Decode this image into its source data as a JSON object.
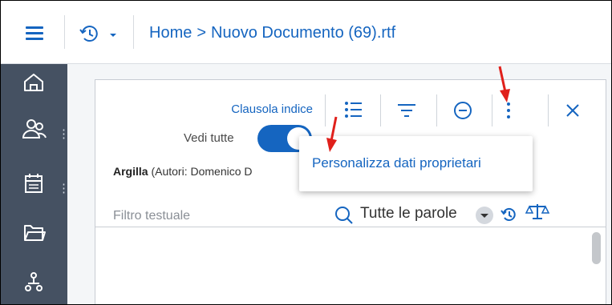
{
  "header": {
    "breadcrumb_home": "Home",
    "breadcrumb_separator": ">",
    "breadcrumb_document": "Nuovo Documento (69).rtf",
    "accent_color": "#1565c0"
  },
  "sidebar": {
    "background": "#455162",
    "items": [
      {
        "icon": "home-icon"
      },
      {
        "icon": "people-icon",
        "more": "⋮"
      },
      {
        "icon": "calendar-icon",
        "more": "⋮"
      },
      {
        "icon": "folder-icon"
      },
      {
        "icon": "org-chart-icon"
      }
    ]
  },
  "panel": {
    "clause_index_label": "Clausola indice",
    "toolbar_icons": [
      "list-icon",
      "filter-icon",
      "minus-circle-icon",
      "more-vertical-icon",
      "close-icon"
    ],
    "show_all_label": "Vedi tutte",
    "show_all_enabled": true,
    "subject_name": "Argilla",
    "subject_authors": "(Autori: Domenico D",
    "filter_placeholder": "Filtro testuale",
    "search_scope": "Tutte le parole"
  },
  "popup": {
    "menu_item": "Personalizza dati proprietari"
  },
  "annotation_color": "#e0201b"
}
